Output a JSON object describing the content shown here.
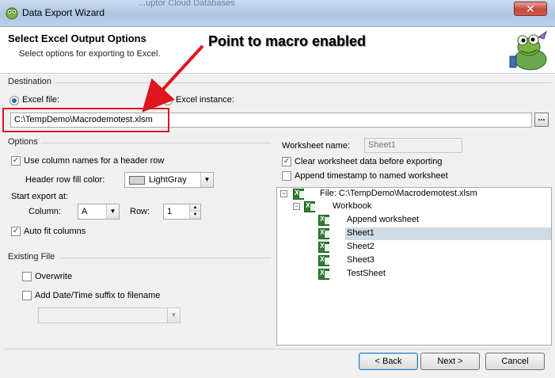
{
  "window": {
    "title": "Data Export Wizard",
    "background_window_text": "...uptor Cloud Databases",
    "close_glyph": "✕"
  },
  "header": {
    "title": "Select Excel Output Options",
    "subtitle": "Select options for exporting to Excel."
  },
  "annotation": {
    "text": "Point to macro enabled",
    "color": "#e0141e"
  },
  "destination": {
    "label": "Destination",
    "excel_file_label": "Excel file:",
    "excel_instance_label": "Excel instance:",
    "selected": "excel_file",
    "file_path": "C:\\TempDemo\\Macrodemotest.xlsm",
    "browse_label": "..."
  },
  "options": {
    "label": "Options",
    "use_column_names_label": "Use column names for a header row",
    "use_column_names_checked": true,
    "header_fill_label": "Header row fill color:",
    "header_fill_value": "LightGray",
    "header_fill_swatch": "#d3d3d3",
    "start_export_label": "Start export at:",
    "column_label": "Column:",
    "column_value": "A",
    "row_label": "Row:",
    "row_value": "1",
    "auto_fit_label": "Auto fit columns",
    "auto_fit_checked": true
  },
  "existing_file": {
    "label": "Existing File",
    "overwrite_label": "Overwrite",
    "overwrite_checked": false,
    "date_suffix_label": "Add Date/Time suffix to filename",
    "date_suffix_checked": false,
    "date_format_value": ""
  },
  "worksheet": {
    "name_label": "Worksheet name:",
    "name_value": "Sheet1",
    "clear_label": "Clear worksheet data before exporting",
    "clear_checked": true,
    "append_ts_label": "Append timestamp to named worksheet",
    "append_ts_checked": false
  },
  "tree": {
    "file_label": "File: C:\\TempDemo\\Macrodemotest.xlsm",
    "workbook_label": "Workbook",
    "sheets": [
      "Append worksheet",
      "Sheet1",
      "Sheet2",
      "Sheet3",
      "TestSheet"
    ],
    "selected_sheet": "Sheet1"
  },
  "buttons": {
    "back": "< Back",
    "next": "Next >",
    "cancel": "Cancel"
  }
}
